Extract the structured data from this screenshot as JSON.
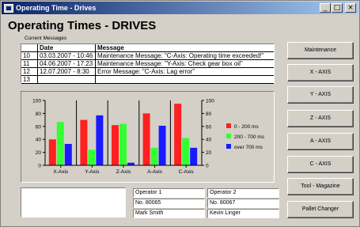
{
  "window": {
    "title": "Operating Time - Drives"
  },
  "heading": "Operating Times - DRIVES",
  "messages": {
    "label": "Current Messages",
    "headers": [
      "",
      "Date",
      "Message"
    ],
    "rows": [
      [
        "10",
        "03.03.2007 - 10:46",
        "Maintenance Message: \"C-Axis: Operating time exceeded!\""
      ],
      [
        "11",
        "04.06.2007 - 17:23",
        "Maintenance Message: \"Y-Axis: Check gear box oil\""
      ],
      [
        "12",
        "12.07.2007 - 8:30",
        "Error Message: \"C-Axis: Lag error\""
      ],
      [
        "13",
        "",
        ""
      ]
    ]
  },
  "chart_data": {
    "type": "bar",
    "categories": [
      "X-Axis",
      "Y-Axis",
      "Z-Axis",
      "A-Axis",
      "C-Axis"
    ],
    "series": [
      {
        "name": "0 - 200 ms",
        "color": "#ff2020",
        "values": [
          40,
          70,
          62,
          80,
          95
        ]
      },
      {
        "name": "200 - 700 ms",
        "color": "#33ff33",
        "values": [
          67,
          24,
          64,
          27,
          42
        ]
      },
      {
        "name": "over 700 ms",
        "color": "#1a1aff",
        "values": [
          33,
          77,
          4,
          61,
          27
        ]
      }
    ],
    "ylim": [
      0,
      100
    ],
    "yticks": [
      "0",
      "20",
      "40",
      "60",
      "80",
      "100"
    ],
    "legend": "right",
    "grid": false
  },
  "operators": {
    "op1_label": "Operator 1",
    "op2_label": "Operator 2",
    "op1_no": "No. 80065",
    "op2_no": "No. 80067",
    "op1_name": "Mark Smith",
    "op2_name": "Kevin Linger"
  },
  "buttons": [
    "Maintenance",
    "X - AXIS",
    "Y - AXIS",
    "Z - AXIS",
    "A - AXIS",
    "C - AXIS",
    "Tool - Magazine",
    "Pallet Changer"
  ]
}
